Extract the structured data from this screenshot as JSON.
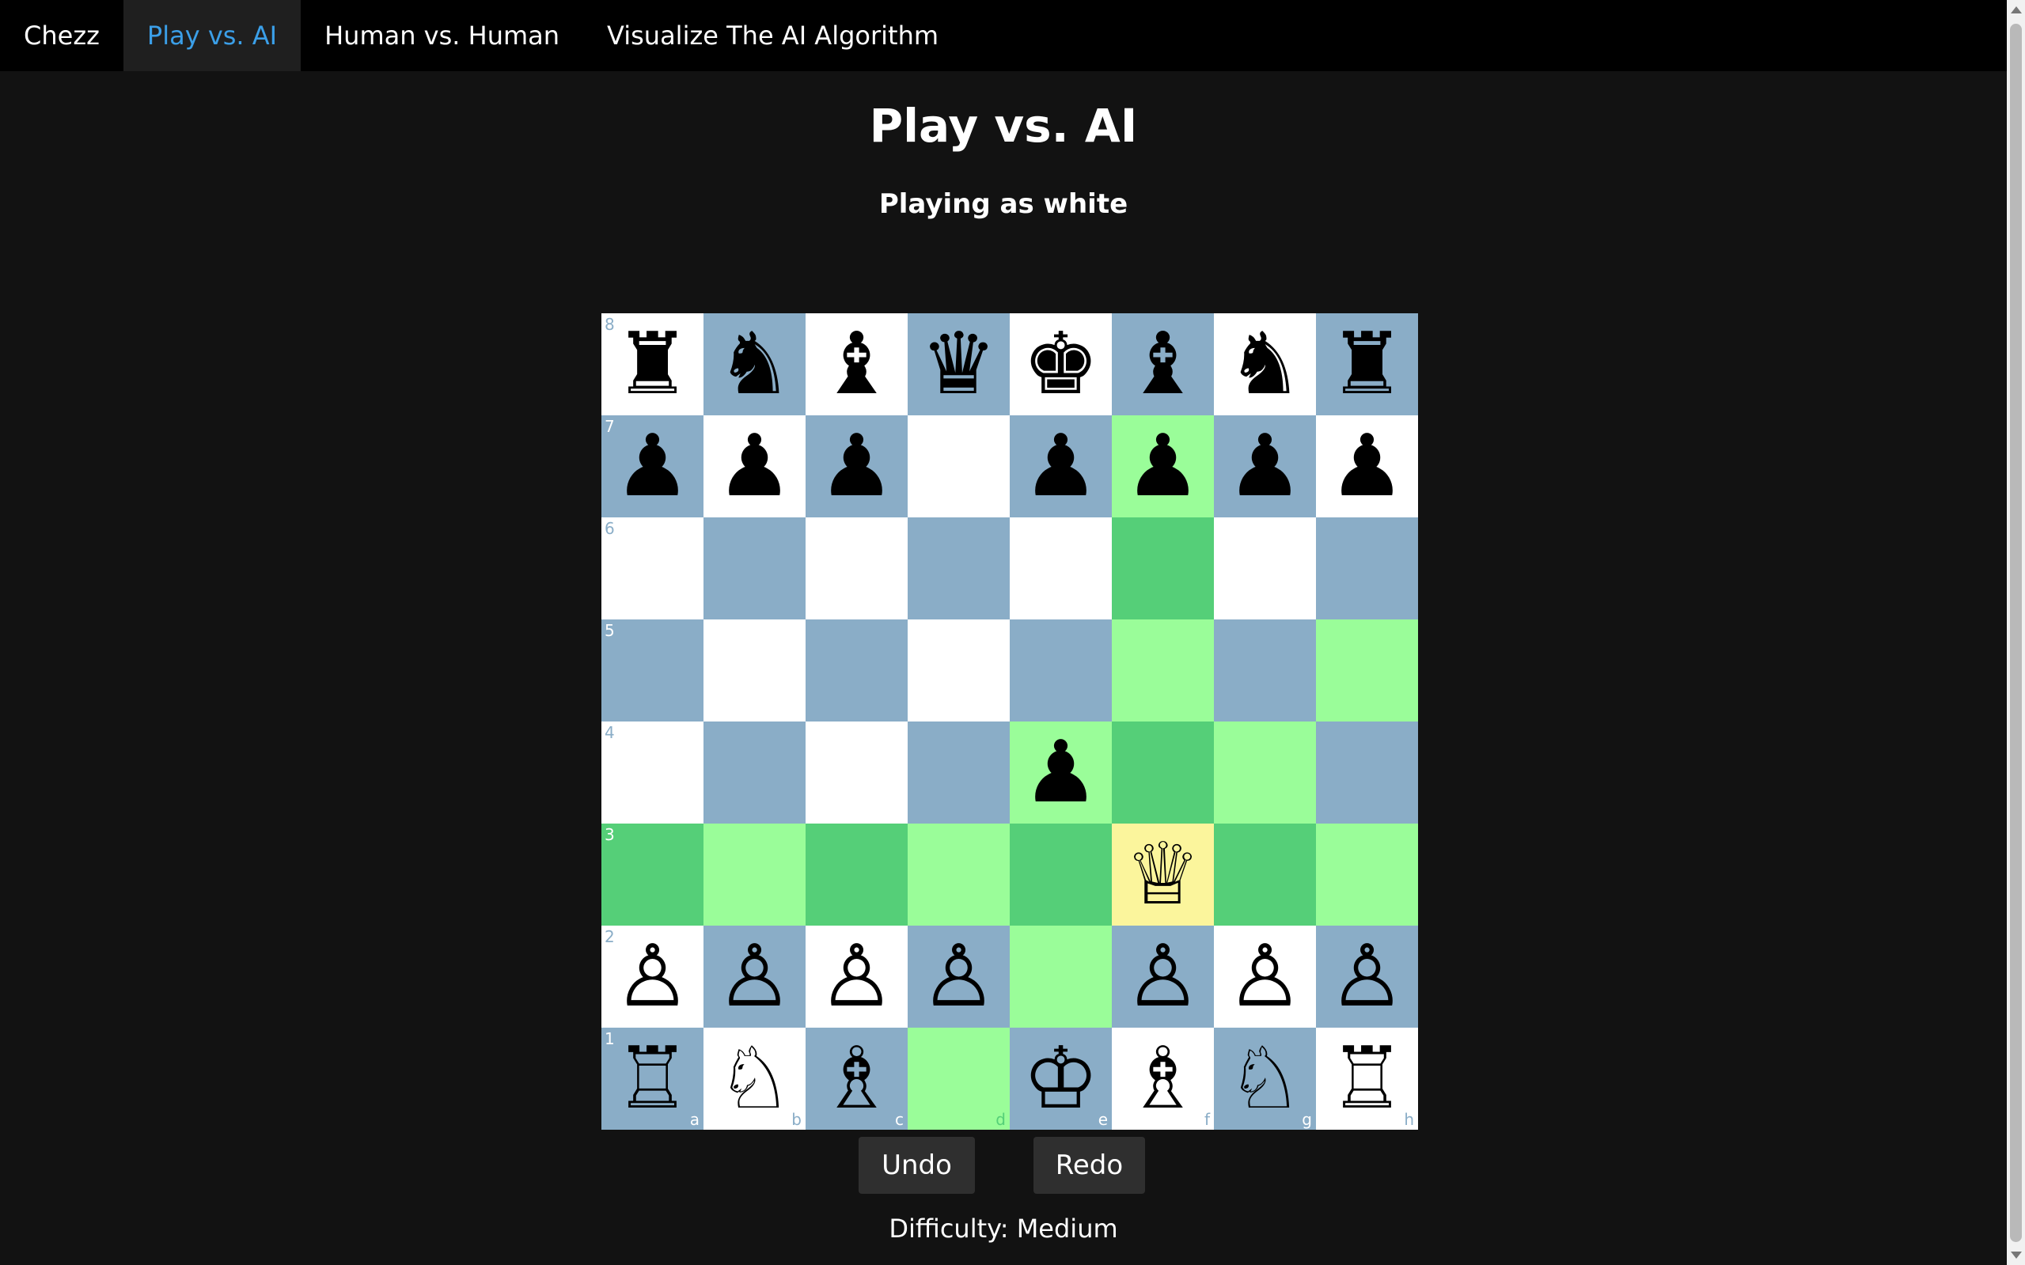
{
  "navbar": {
    "brand": "Chezz",
    "items": [
      {
        "label": "Play vs. AI",
        "active": true
      },
      {
        "label": "Human vs. Human",
        "active": false
      },
      {
        "label": "Visualize The AI Algorithm",
        "active": false
      }
    ]
  },
  "page": {
    "title": "Play vs. AI",
    "subtitle": "Playing as white"
  },
  "board": {
    "files": [
      "a",
      "b",
      "c",
      "d",
      "e",
      "f",
      "g",
      "h"
    ],
    "ranks": [
      "8",
      "7",
      "6",
      "5",
      "4",
      "3",
      "2",
      "1"
    ],
    "rows": [
      [
        "br",
        "bn",
        "bb",
        "bq",
        "bk",
        "bb",
        "bn",
        "br"
      ],
      [
        "bp",
        "bp",
        "bp",
        "",
        "bp",
        "bp",
        "bp",
        "bp"
      ],
      [
        "",
        "",
        "",
        "",
        "",
        "",
        "",
        ""
      ],
      [
        "",
        "",
        "",
        "",
        "",
        "",
        "",
        ""
      ],
      [
        "",
        "",
        "",
        "",
        "bp",
        "",
        "",
        ""
      ],
      [
        "",
        "",
        "",
        "",
        "",
        "wq",
        "",
        ""
      ],
      [
        "wp",
        "wp",
        "wp",
        "wp",
        "",
        "wp",
        "wp",
        "wp"
      ],
      [
        "wr",
        "wn",
        "wb",
        "",
        "wk",
        "wb",
        "wn",
        "wr"
      ]
    ],
    "selected_square": "f3",
    "move_targets": [
      "f7",
      "f6",
      "f5",
      "h5",
      "f4",
      "g4",
      "e4",
      "a3",
      "b3",
      "c3",
      "d3",
      "e3",
      "g3",
      "h3",
      "e2",
      "d1"
    ],
    "colors": {
      "light": "#ffffff",
      "dark": "#8aadc7",
      "move_on_light": "#9afd99",
      "move_on_dark": "#55cf78",
      "selected": "#fbf59c"
    }
  },
  "controls": {
    "undo_label": "Undo",
    "redo_label": "Redo",
    "difficulty_text": "Difficulty: Medium"
  }
}
